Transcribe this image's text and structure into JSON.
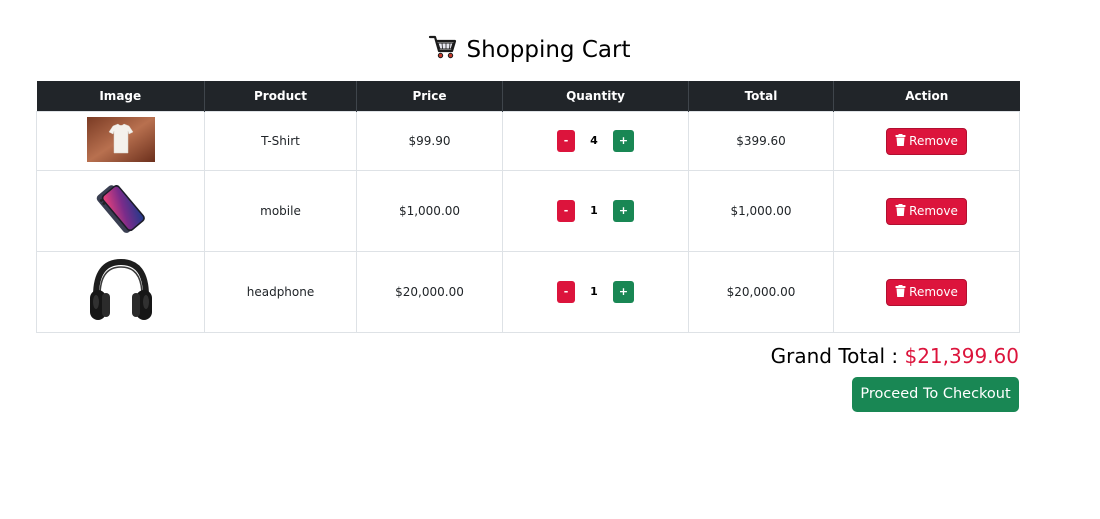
{
  "page": {
    "title": "Shopping Cart",
    "title_icon": "shopping-cart-icon"
  },
  "table": {
    "headers": [
      "Image",
      "Product",
      "Price",
      "Quantity",
      "Total",
      "Action"
    ],
    "rows": [
      {
        "image": "tshirt-image",
        "product": "T-Shirt",
        "price": "$99.90",
        "quantity": "4",
        "total": "$399.60",
        "minus": "-",
        "plus": "+",
        "action": "Remove"
      },
      {
        "image": "mobile-image",
        "product": "mobile",
        "price": "$1,000.00",
        "quantity": "1",
        "total": "$1,000.00",
        "minus": "-",
        "plus": "+",
        "action": "Remove"
      },
      {
        "image": "headphone-image",
        "product": "headphone",
        "price": "$20,000.00",
        "quantity": "1",
        "total": "$20,000.00",
        "minus": "-",
        "plus": "+",
        "action": "Remove"
      }
    ]
  },
  "summary": {
    "grand_total_label": "Grand Total :",
    "grand_total_value": "$21,399.60",
    "checkout_label": "Proceed To Checkout"
  },
  "colors": {
    "header_bg": "#212529",
    "danger": "#dc143c",
    "success": "#198754"
  }
}
